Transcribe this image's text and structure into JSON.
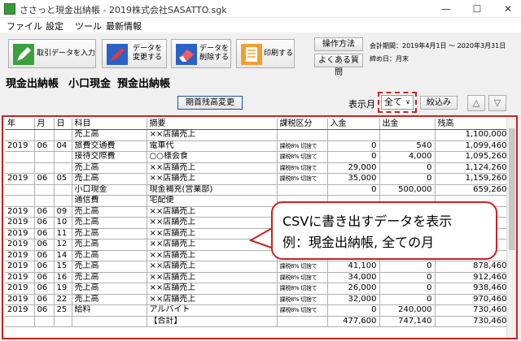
{
  "window": {
    "title": "ささっと現金出納帳 - 2019株式会社SASATTO.sgk"
  },
  "menu": [
    "ファイル",
    "設定",
    "ツール",
    "最新情報"
  ],
  "toolbar": {
    "input": "取引データを入力",
    "edit": "データを\n変更する",
    "delete": "データを\n削除する",
    "print": "印刷する",
    "manual": "操作方法",
    "faq": "よくある質問",
    "period_label": "会計期間：2019年4月1日 ～ 2020年3月31日",
    "closing_label": "締め日：月末"
  },
  "tabs": [
    "現金出納帳",
    "小口現金",
    "預金出納帳"
  ],
  "actions": {
    "opening_balance": "期首残高変更",
    "month_label": "表示月",
    "month_value": "全て",
    "filter": "絞込み",
    "up": "△",
    "down": "▽"
  },
  "grid": {
    "columns": [
      "年",
      "月",
      "日",
      "科目",
      "摘要",
      "課税区分",
      "入金",
      "出金",
      "残高"
    ],
    "rows": [
      [
        "",
        "",
        "",
        "売上高",
        "××店舗売上",
        "",
        "",
        "",
        "1,100,000"
      ],
      [
        "2019",
        "06",
        "04",
        "旅費交通費",
        "電車代",
        "課税8% 切捨て",
        "0",
        "540",
        "1,099,460"
      ],
      [
        "",
        "",
        "",
        "接待交際費",
        "○○様会食",
        "課税8% 切捨て",
        "0",
        "4,000",
        "1,095,260"
      ],
      [
        "",
        "",
        "",
        "売上高",
        "××店舗売上",
        "課税8% 切捨て",
        "29,000",
        "0",
        "1,124,260"
      ],
      [
        "2019",
        "06",
        "05",
        "売上高",
        "××店舗売上",
        "課税8% 切捨て",
        "35,000",
        "0",
        "1,159,260"
      ],
      [
        "",
        "",
        "",
        "小口現金",
        "現金補充(営業部)",
        "",
        "0",
        "500,000",
        "659,260"
      ],
      [
        "",
        "",
        "",
        "通信費",
        "宅配便",
        "",
        "",
        "",
        ""
      ],
      [
        "2019",
        "06",
        "09",
        "売上高",
        "××店舗売上",
        "",
        "",
        "",
        ""
      ],
      [
        "2019",
        "06",
        "10",
        "売上高",
        "××店舗売上",
        "",
        "",
        "",
        ""
      ],
      [
        "2019",
        "06",
        "11",
        "売上高",
        "××店舗売上",
        "",
        "",
        "",
        ""
      ],
      [
        "2019",
        "06",
        "12",
        "売上高",
        "××店舗売上",
        "",
        "",
        "",
        ""
      ],
      [
        "2019",
        "06",
        "14",
        "売上高",
        "××店舗売上",
        "",
        "",
        "",
        ""
      ],
      [
        "2019",
        "06",
        "15",
        "売上高",
        "××店舗売上",
        "課税8% 切捨て",
        "41,100",
        "0",
        "878,460"
      ],
      [
        "2019",
        "06",
        "16",
        "売上高",
        "××店舗売上",
        "課税8% 切捨て",
        "34,000",
        "0",
        "912,460"
      ],
      [
        "2019",
        "06",
        "19",
        "売上高",
        "××店舗売上",
        "課税8% 切捨て",
        "26,000",
        "0",
        "938,460"
      ],
      [
        "2019",
        "06",
        "22",
        "売上高",
        "××店舗売上",
        "課税8% 切捨て",
        "32,000",
        "0",
        "970,460"
      ],
      [
        "2019",
        "06",
        "25",
        "給料",
        "アルバイト",
        "課税8% 切捨て",
        "0",
        "240,000",
        "730,460"
      ],
      [
        "",
        "",
        "",
        "",
        "【合計】",
        "",
        "477,600",
        "747,140",
        "730,460"
      ]
    ]
  },
  "callout": {
    "line1": "CSVに書き出すデータを表示",
    "line2": "例：現金出納帳, 全ての月"
  },
  "colors": {
    "highlight": "#cc2222",
    "accent_blue": "#1a4fa0"
  }
}
